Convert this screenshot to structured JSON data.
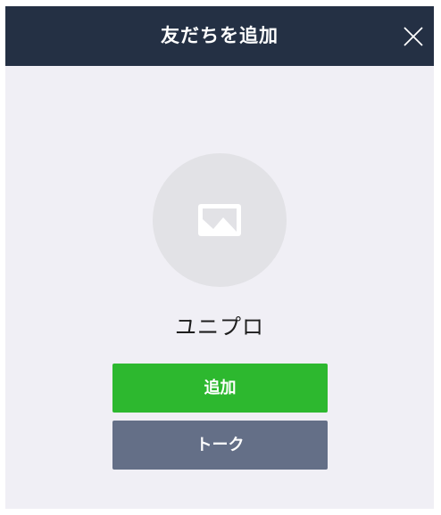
{
  "dialog": {
    "title": "友だちを追加",
    "close_icon": "close-icon"
  },
  "profile": {
    "avatar_icon": "image-icon",
    "name": "ユニプロ"
  },
  "actions": {
    "add_label": "追加",
    "talk_label": "トーク"
  },
  "colors": {
    "header_bg": "#243044",
    "dialog_bg": "#f0eff5",
    "add_button": "#2db82f",
    "talk_button": "#646f87",
    "avatar_bg": "#e2e2e6"
  }
}
